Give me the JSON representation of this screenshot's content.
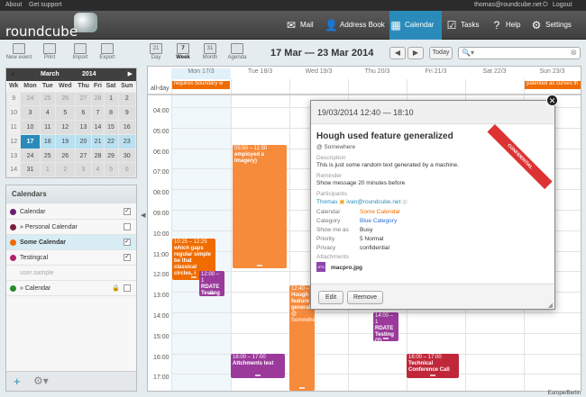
{
  "topbar": {
    "about": "About",
    "support": "Get support",
    "user": "thomas@roundcube.net",
    "logout": "Logout"
  },
  "app": {
    "logo": "roundcube"
  },
  "nav": [
    {
      "label": "Mail",
      "icon": "envelope-icon"
    },
    {
      "label": "Address Book",
      "icon": "person-icon"
    },
    {
      "label": "Calendar",
      "icon": "calendar-icon"
    },
    {
      "label": "Tasks",
      "icon": "checkbox-icon"
    },
    {
      "label": "Help",
      "icon": "help-icon"
    },
    {
      "label": "Settings",
      "icon": "gear-icon"
    }
  ],
  "toolbar": {
    "new_event": "New event",
    "print": "Print",
    "import": "Import",
    "export": "Export",
    "day": "Day",
    "day_num": "21",
    "week": "Week",
    "week_num": "7",
    "month": "Month",
    "month_num": "31",
    "agenda": "Agenda"
  },
  "view": {
    "date_range": "17 Mar — 23 Mar 2014",
    "prev": "◀",
    "next": "▶",
    "today": "Today"
  },
  "search": {
    "placeholder": ""
  },
  "minical": {
    "month": "March",
    "year": "2014",
    "weekdays": [
      "Wk",
      "Mon",
      "Tue",
      "Wed",
      "Thu",
      "Fri",
      "Sat",
      "Sun"
    ],
    "weeks": [
      [
        "9",
        "24",
        "25",
        "26",
        "27",
        "28",
        "1",
        "2"
      ],
      [
        "10",
        "3",
        "4",
        "5",
        "6",
        "7",
        "8",
        "9"
      ],
      [
        "11",
        "10",
        "11",
        "12",
        "13",
        "14",
        "15",
        "16"
      ],
      [
        "12",
        "17",
        "18",
        "19",
        "20",
        "21",
        "22",
        "23"
      ],
      [
        "13",
        "24",
        "25",
        "26",
        "27",
        "28",
        "29",
        "30"
      ],
      [
        "14",
        "31",
        "1",
        "2",
        "3",
        "4",
        "5",
        "6"
      ]
    ]
  },
  "calendars": {
    "title": "Calendars",
    "items": [
      {
        "name": "Calendar",
        "color": "#6a1f6d",
        "checked": true
      },
      {
        "name": "» Personal Calendar",
        "color": "#7a1f3d",
        "checked": false
      },
      {
        "name": "Some Calendar",
        "color": "#f06b00",
        "checked": true
      },
      {
        "name": "Testingcal",
        "color": "#b0226a",
        "checked": true
      },
      {
        "name": "user.sample",
        "color": "",
        "checked": false
      },
      {
        "name": "» Calendar",
        "color": "#2a8b2a",
        "checked": false
      }
    ]
  },
  "week": {
    "allday_label": "all-day",
    "days": [
      "Mon 17/3",
      "Tue 18/3",
      "Wed 19/3",
      "Thu 20/3",
      "Fri 21/3",
      "Sat 22/3",
      "Sun 23/3"
    ],
    "hours": [
      "04:00",
      "05:00",
      "06:00",
      "07:00",
      "08:00",
      "09:00",
      "10:00",
      "11:00",
      "12:00",
      "13:00",
      "14:00",
      "15:00",
      "16:00",
      "17:00"
    ],
    "allday_events": [
      {
        "text": "requires boundary w"
      },
      {
        "text": "patented as curves th"
      }
    ],
    "events": [
      {
        "time": "05:50 – 11:50",
        "title": "employed a Imagery)",
        "color": "#f68b3c"
      },
      {
        "time": "10:25 – 12:25",
        "title": "which gaps regular simple be that classical circles, i",
        "color": "#f06b00"
      },
      {
        "time": "12:00 – 1",
        "title": "RDATE Testing",
        "color": "#9b3a9b"
      },
      {
        "time": "12:40 –",
        "title": "Hough feature generalized",
        "sub": "@ Somewhere",
        "color": "#f68b3c"
      },
      {
        "time": "14:00 – 1",
        "title": "RDATE Testing (2)",
        "color": "#9b3a9b"
      },
      {
        "time": "16:00 – 17:00",
        "title": "Attchments test",
        "color": "#9b3a9b"
      },
      {
        "time": "16:00 – 17:00",
        "title": "Technical Conference Call",
        "color": "#c0283a"
      }
    ]
  },
  "popup": {
    "datetime": "19/03/2014 12:40 — 18:10",
    "badge": "CONFIDENTIAL",
    "title": "Hough used feature generalized",
    "location": "@ Somewhere",
    "description_label": "Description",
    "description": "This is just some random text generated by a machine.",
    "reminder_label": "Reminder",
    "reminder": "Show message 20 minutes before",
    "participants_label": "Participants",
    "participant1": "Thomas",
    "participant2": "ivan@roundcube.net",
    "calendar_label": "Calendar",
    "calendar": "Some Calendar",
    "category_label": "Category",
    "category": "Blue Category",
    "showmeas_label": "Show me as",
    "showmeas": "Busy",
    "priority_label": "Priority",
    "priority": "5 Normal",
    "privacy_label": "Privacy",
    "privacy": "confidential",
    "attachments_label": "Attachments",
    "attachment": "macpro.jpg",
    "attachment_type": "JPG",
    "edit": "Edit",
    "remove": "Remove"
  },
  "timezone": "Europe/Berlin",
  "colors": {
    "accent": "#2a8bbb",
    "orange": "#f06b00",
    "purple": "#9b3a9b",
    "red": "#c0283a"
  }
}
